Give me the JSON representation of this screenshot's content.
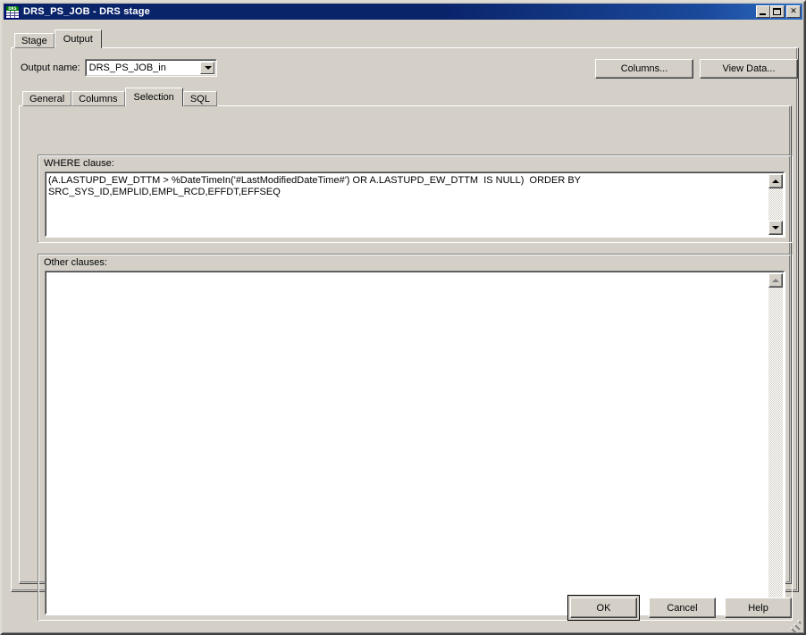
{
  "window": {
    "title": "DRS_PS_JOB - DRS stage",
    "icon": "drs-grid-icon",
    "icon_label": "DRS",
    "controls": {
      "minimize": "minimize-button",
      "maximize": "maximize-button",
      "close_glyph": "✕"
    },
    "colors": {
      "titlebar_start": "#0a246a",
      "titlebar_end": "#2f6dc4",
      "face": "#d4d0c8",
      "field": "#ffffff",
      "shadow": "#808080",
      "dark": "#404040"
    }
  },
  "outer_tabs": [
    {
      "label": "Stage",
      "active": false
    },
    {
      "label": "Output",
      "active": true
    }
  ],
  "output_name": {
    "label": "Output name:",
    "value": "DRS_PS_JOB_in"
  },
  "top_buttons": {
    "columns": "Columns...",
    "view_data": "View Data..."
  },
  "inner_tabs": [
    {
      "label": "General",
      "active": false
    },
    {
      "label": "Columns",
      "active": false
    },
    {
      "label": "Selection",
      "active": true
    },
    {
      "label": "SQL",
      "active": false
    }
  ],
  "where_clause": {
    "label": "WHERE clause:",
    "value": "(A.LASTUPD_EW_DTTM > %DateTimeIn('#LastModifiedDateTime#') OR A.LASTUPD_EW_DTTM  IS NULL)  ORDER BY\nSRC_SYS_ID,EMPLID,EMPL_RCD,EFFDT,EFFSEQ"
  },
  "other_clauses": {
    "label": "Other clauses:",
    "value": ""
  },
  "footer_buttons": {
    "ok": "OK",
    "cancel": "Cancel",
    "help": "Help"
  }
}
